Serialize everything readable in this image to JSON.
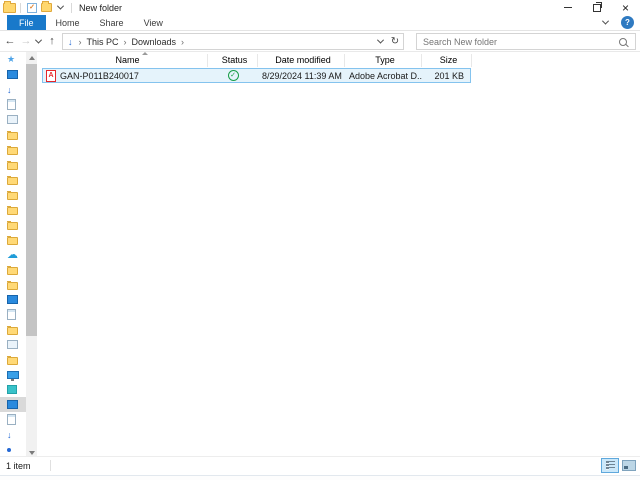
{
  "window": {
    "title": "New folder"
  },
  "glyphs": {
    "close": "×",
    "back": "←",
    "forward": "→",
    "up": "↑",
    "refresh": "↻",
    "breadcrumb_sep": "›",
    "location_arrow": "↓"
  },
  "ribbon": {
    "tabs": [
      "File",
      "Home",
      "Share",
      "View"
    ],
    "active_tab": "File",
    "help_label": "?"
  },
  "navigation": {
    "breadcrumb": [
      "This PC",
      "Downloads"
    ],
    "search_placeholder": "Search New folder"
  },
  "file_list": {
    "columns": [
      "Name",
      "Status",
      "Date modified",
      "Type",
      "Size"
    ],
    "sort_column": "Name",
    "sort_direction": "ascending",
    "rows": [
      {
        "name": "GAN-P011B240017",
        "file_icon": "pdf-icon",
        "status": "synced",
        "date_modified": "8/29/2024 11:39 AM",
        "type": "Adobe Acrobat D...",
        "size": "201 KB",
        "selected": true
      }
    ]
  },
  "sidebar": {
    "icons": [
      "quick-access",
      "desktop",
      "downloads",
      "documents",
      "pictures",
      "folder",
      "folder",
      "folder",
      "folder",
      "folder",
      "folder",
      "folder",
      "folder",
      "onedrive",
      "folder",
      "folder",
      "desktop",
      "documents",
      "folder",
      "pictures",
      "folder",
      "this-pc",
      "devices",
      "desktop",
      "documents",
      "downloads",
      "network-dot"
    ],
    "selected_index": 23
  },
  "status_bar": {
    "items_count": "1 item"
  },
  "colors": {
    "accent": "#1979ca",
    "selection_bg": "#e5f3fb",
    "selection_border": "#84c3ee",
    "status_green": "#199e47",
    "pdf_red": "#e5252a"
  }
}
